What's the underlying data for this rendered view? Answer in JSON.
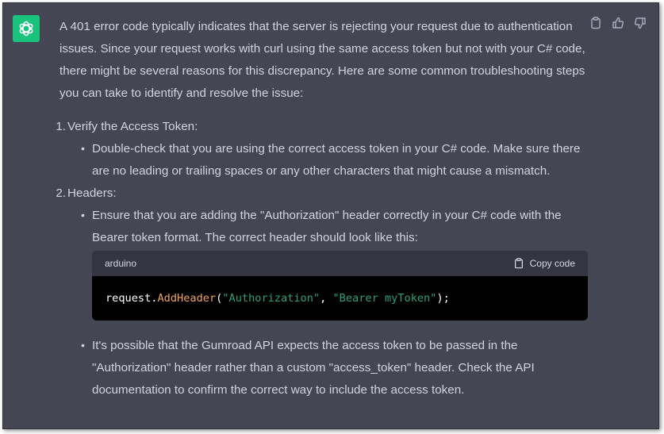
{
  "message": {
    "intro": "A 401 error code typically indicates that the server is rejecting your request due to authentication issues. Since your request works with curl using the same access token but not with your C# code, there might be several reasons for this discrepancy. Here are some common troubleshooting steps you can take to identify and resolve the issue:",
    "steps": [
      {
        "number": "1.",
        "title": "Verify the Access Token:",
        "bullets": [
          "Double-check that you are using the correct access token in your C# code. Make sure there are no leading or trailing spaces or any other characters that might cause a mismatch."
        ]
      },
      {
        "number": "2.",
        "title": "Headers:",
        "bullets": [
          "Ensure that you are adding the \"Authorization\" header correctly in your C# code with the Bearer token format. The correct header should look like this:",
          "It's possible that the Gumroad API expects the access token to be passed in the \"Authorization\" header rather than a custom \"access_token\" header. Check the API documentation to confirm the correct way to include the access token."
        ]
      }
    ],
    "code_block": {
      "language": "arduino",
      "copy_label": "Copy code",
      "tokens": {
        "obj": "request.",
        "method": "AddHeader",
        "open": "(",
        "arg1": "\"Authorization\"",
        "sep": ", ",
        "arg2": "\"Bearer myToken\"",
        "close": ");"
      }
    }
  },
  "icons": {
    "avatar": "openai-logo-icon",
    "copy": "clipboard-icon",
    "like": "thumbs-up-icon",
    "dislike": "thumbs-down-icon"
  },
  "colors": {
    "background": "#444654",
    "avatar": "#19c37d",
    "text": "#d1d5db",
    "code_function": "#f0a45d",
    "code_string": "#2aa17a"
  }
}
